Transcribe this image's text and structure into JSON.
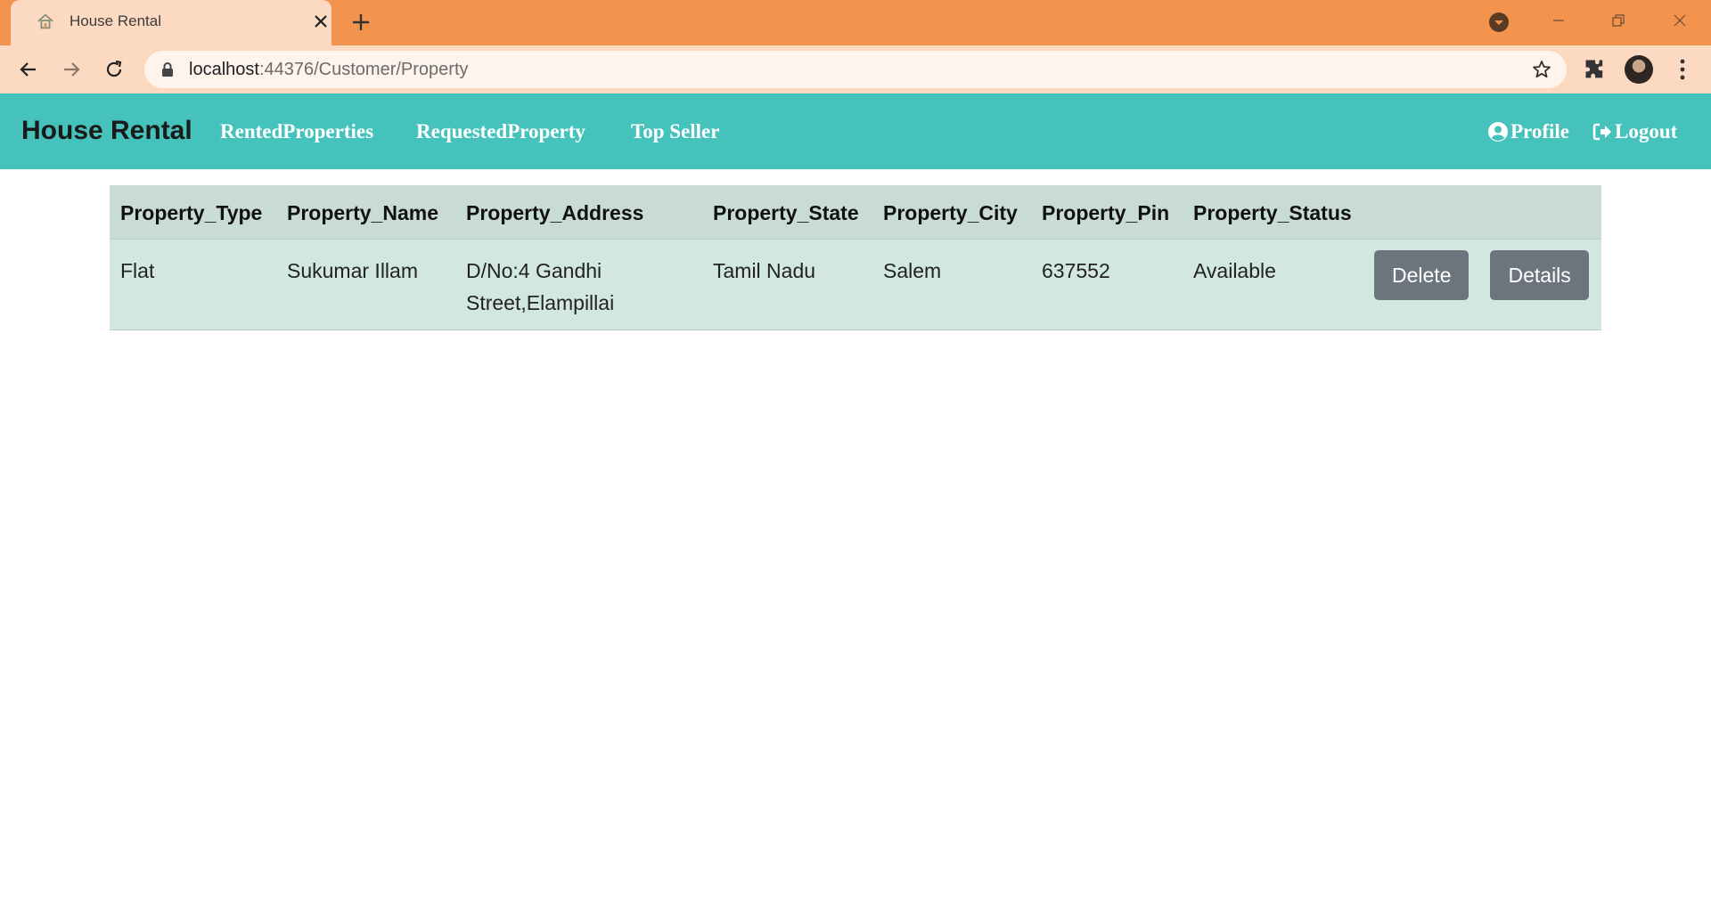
{
  "browser": {
    "tab_title": "House Rental",
    "url_host": "localhost",
    "url_path": ":44376/Customer/Property"
  },
  "navbar": {
    "brand": "House Rental",
    "links": [
      "RentedProperties",
      "RequestedProperty",
      "Top Seller"
    ],
    "profile_label": "Profile",
    "logout_label": "Logout"
  },
  "table": {
    "columns": [
      "Property_Type",
      "Property_Name",
      "Property_Address",
      "Property_State",
      "Property_City",
      "Property_Pin",
      "Property_Status"
    ],
    "rows": [
      {
        "type": "Flat",
        "name": "Sukumar Illam",
        "address": "D/No:4 Gandhi Street,Elampillai",
        "state": "Tamil Nadu",
        "city": "Salem",
        "pin": "637552",
        "status": "Available",
        "delete_label": "Delete",
        "details_label": "Details"
      }
    ]
  },
  "icons": {
    "tab_favicon": "house-icon",
    "profile": "user-circle-icon",
    "logout": "sign-out-icon"
  },
  "colors": {
    "tab_strip": "#f2944e",
    "toolbar": "#fcd9c1",
    "navbar": "#45c2bc",
    "table_header": "#c8dcd3",
    "table_row": "#d2e8de",
    "button": "#6c757d"
  }
}
